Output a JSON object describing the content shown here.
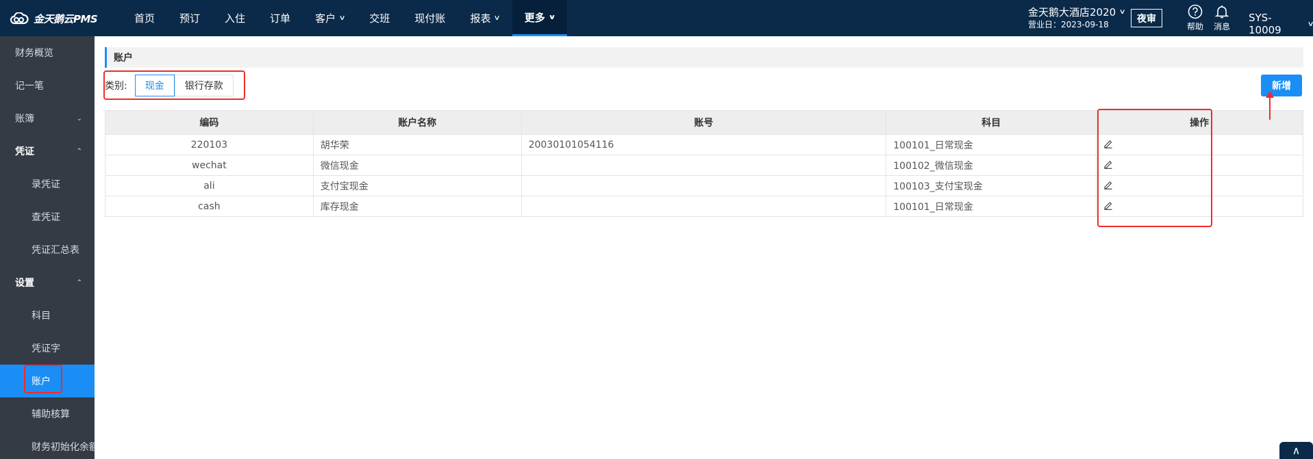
{
  "app": {
    "logo_text": "金天鹅云PMS"
  },
  "nav": [
    {
      "label": "首页",
      "chevron": ""
    },
    {
      "label": "预订",
      "chevron": ""
    },
    {
      "label": "入住",
      "chevron": ""
    },
    {
      "label": "订单",
      "chevron": ""
    },
    {
      "label": "客户",
      "chevron": "∨"
    },
    {
      "label": "交班",
      "chevron": ""
    },
    {
      "label": "现付账",
      "chevron": ""
    },
    {
      "label": "报表",
      "chevron": "∨"
    },
    {
      "label": "更多",
      "chevron": "∨"
    }
  ],
  "header": {
    "hotel_name": "金天鹅大酒店2020",
    "business_date": "营业日：2023-09-18",
    "night_audit": "夜审",
    "help": "帮助",
    "message": "消息",
    "user": "SYS-10009",
    "dropdown_glyph": "∨"
  },
  "sidebar": [
    {
      "label": "财务概览",
      "type": "top"
    },
    {
      "label": "记一笔",
      "type": "top"
    },
    {
      "label": "账簿",
      "type": "top",
      "caret": "⌄"
    },
    {
      "label": "凭证",
      "type": "head",
      "caret": "⌃"
    },
    {
      "label": "录凭证",
      "type": "sub"
    },
    {
      "label": "查凭证",
      "type": "sub"
    },
    {
      "label": "凭证汇总表",
      "type": "sub"
    },
    {
      "label": "设置",
      "type": "head",
      "caret": "⌃"
    },
    {
      "label": "科目",
      "type": "sub"
    },
    {
      "label": "凭证字",
      "type": "sub"
    },
    {
      "label": "账户",
      "type": "sub",
      "selected": true
    },
    {
      "label": "辅助核算",
      "type": "sub"
    },
    {
      "label": "财务初始化余额",
      "type": "sub"
    }
  ],
  "main": {
    "section_title": "账户",
    "filter_label": "类别:",
    "categories": [
      "现金",
      "银行存款"
    ],
    "active_category": "现金",
    "add_button": "新增",
    "table": {
      "headers": [
        "编码",
        "账户名称",
        "账号",
        "科目",
        "操作"
      ],
      "rows": [
        [
          "220103",
          "胡华荣",
          "20030101054116",
          "100101_日常现金"
        ],
        [
          "wechat",
          "微信现金",
          "",
          "100102_微信现金"
        ],
        [
          "ali",
          "支付宝现金",
          "",
          "100103_支付宝现金"
        ],
        [
          "cash",
          "库存现金",
          "",
          "100101_日常现金"
        ]
      ]
    }
  },
  "colors": {
    "topbar": "#0b2a4a",
    "sidebar": "#353b45",
    "accent": "#1a8ef5",
    "annotation": "#f02b2b"
  },
  "icons": {
    "edit": "edit-icon",
    "help": "help-circle-icon",
    "bell": "bell-icon",
    "logo": "cloud-icon",
    "scroll": "chevron-up-icon"
  },
  "scroll_top": "∧"
}
